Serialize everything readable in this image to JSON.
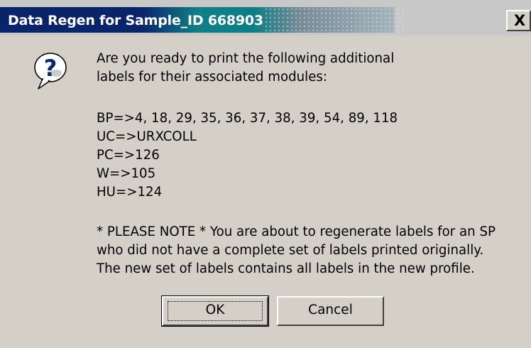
{
  "window": {
    "title": "Data Regen for Sample_ID 668903",
    "close_glyph": "X",
    "close_icon": "close-icon"
  },
  "icon": {
    "name": "help-question-icon",
    "glyph": "?"
  },
  "message": {
    "intro": [
      "Are you ready to print the following additional",
      "labels for their associated modules:"
    ],
    "modules": [
      "BP=>4, 18, 29, 35, 36, 37, 38, 39, 54, 89, 118",
      "UC=>URXCOLL",
      "PC=>126",
      "W=>105",
      "HU=>124"
    ],
    "note": [
      "* PLEASE NOTE * You are about to regenerate labels for an SP",
      "who did not have a complete set of labels printed originally.",
      "The new set of labels contains all labels in the new profile."
    ]
  },
  "buttons": {
    "ok_label": "OK",
    "cancel_label": "Cancel"
  },
  "colors": {
    "title_active": "#0a246a",
    "title_gradient_mid": "#127f86",
    "dialog_face": "#d4d0c8",
    "title_text": "#ffffff"
  }
}
